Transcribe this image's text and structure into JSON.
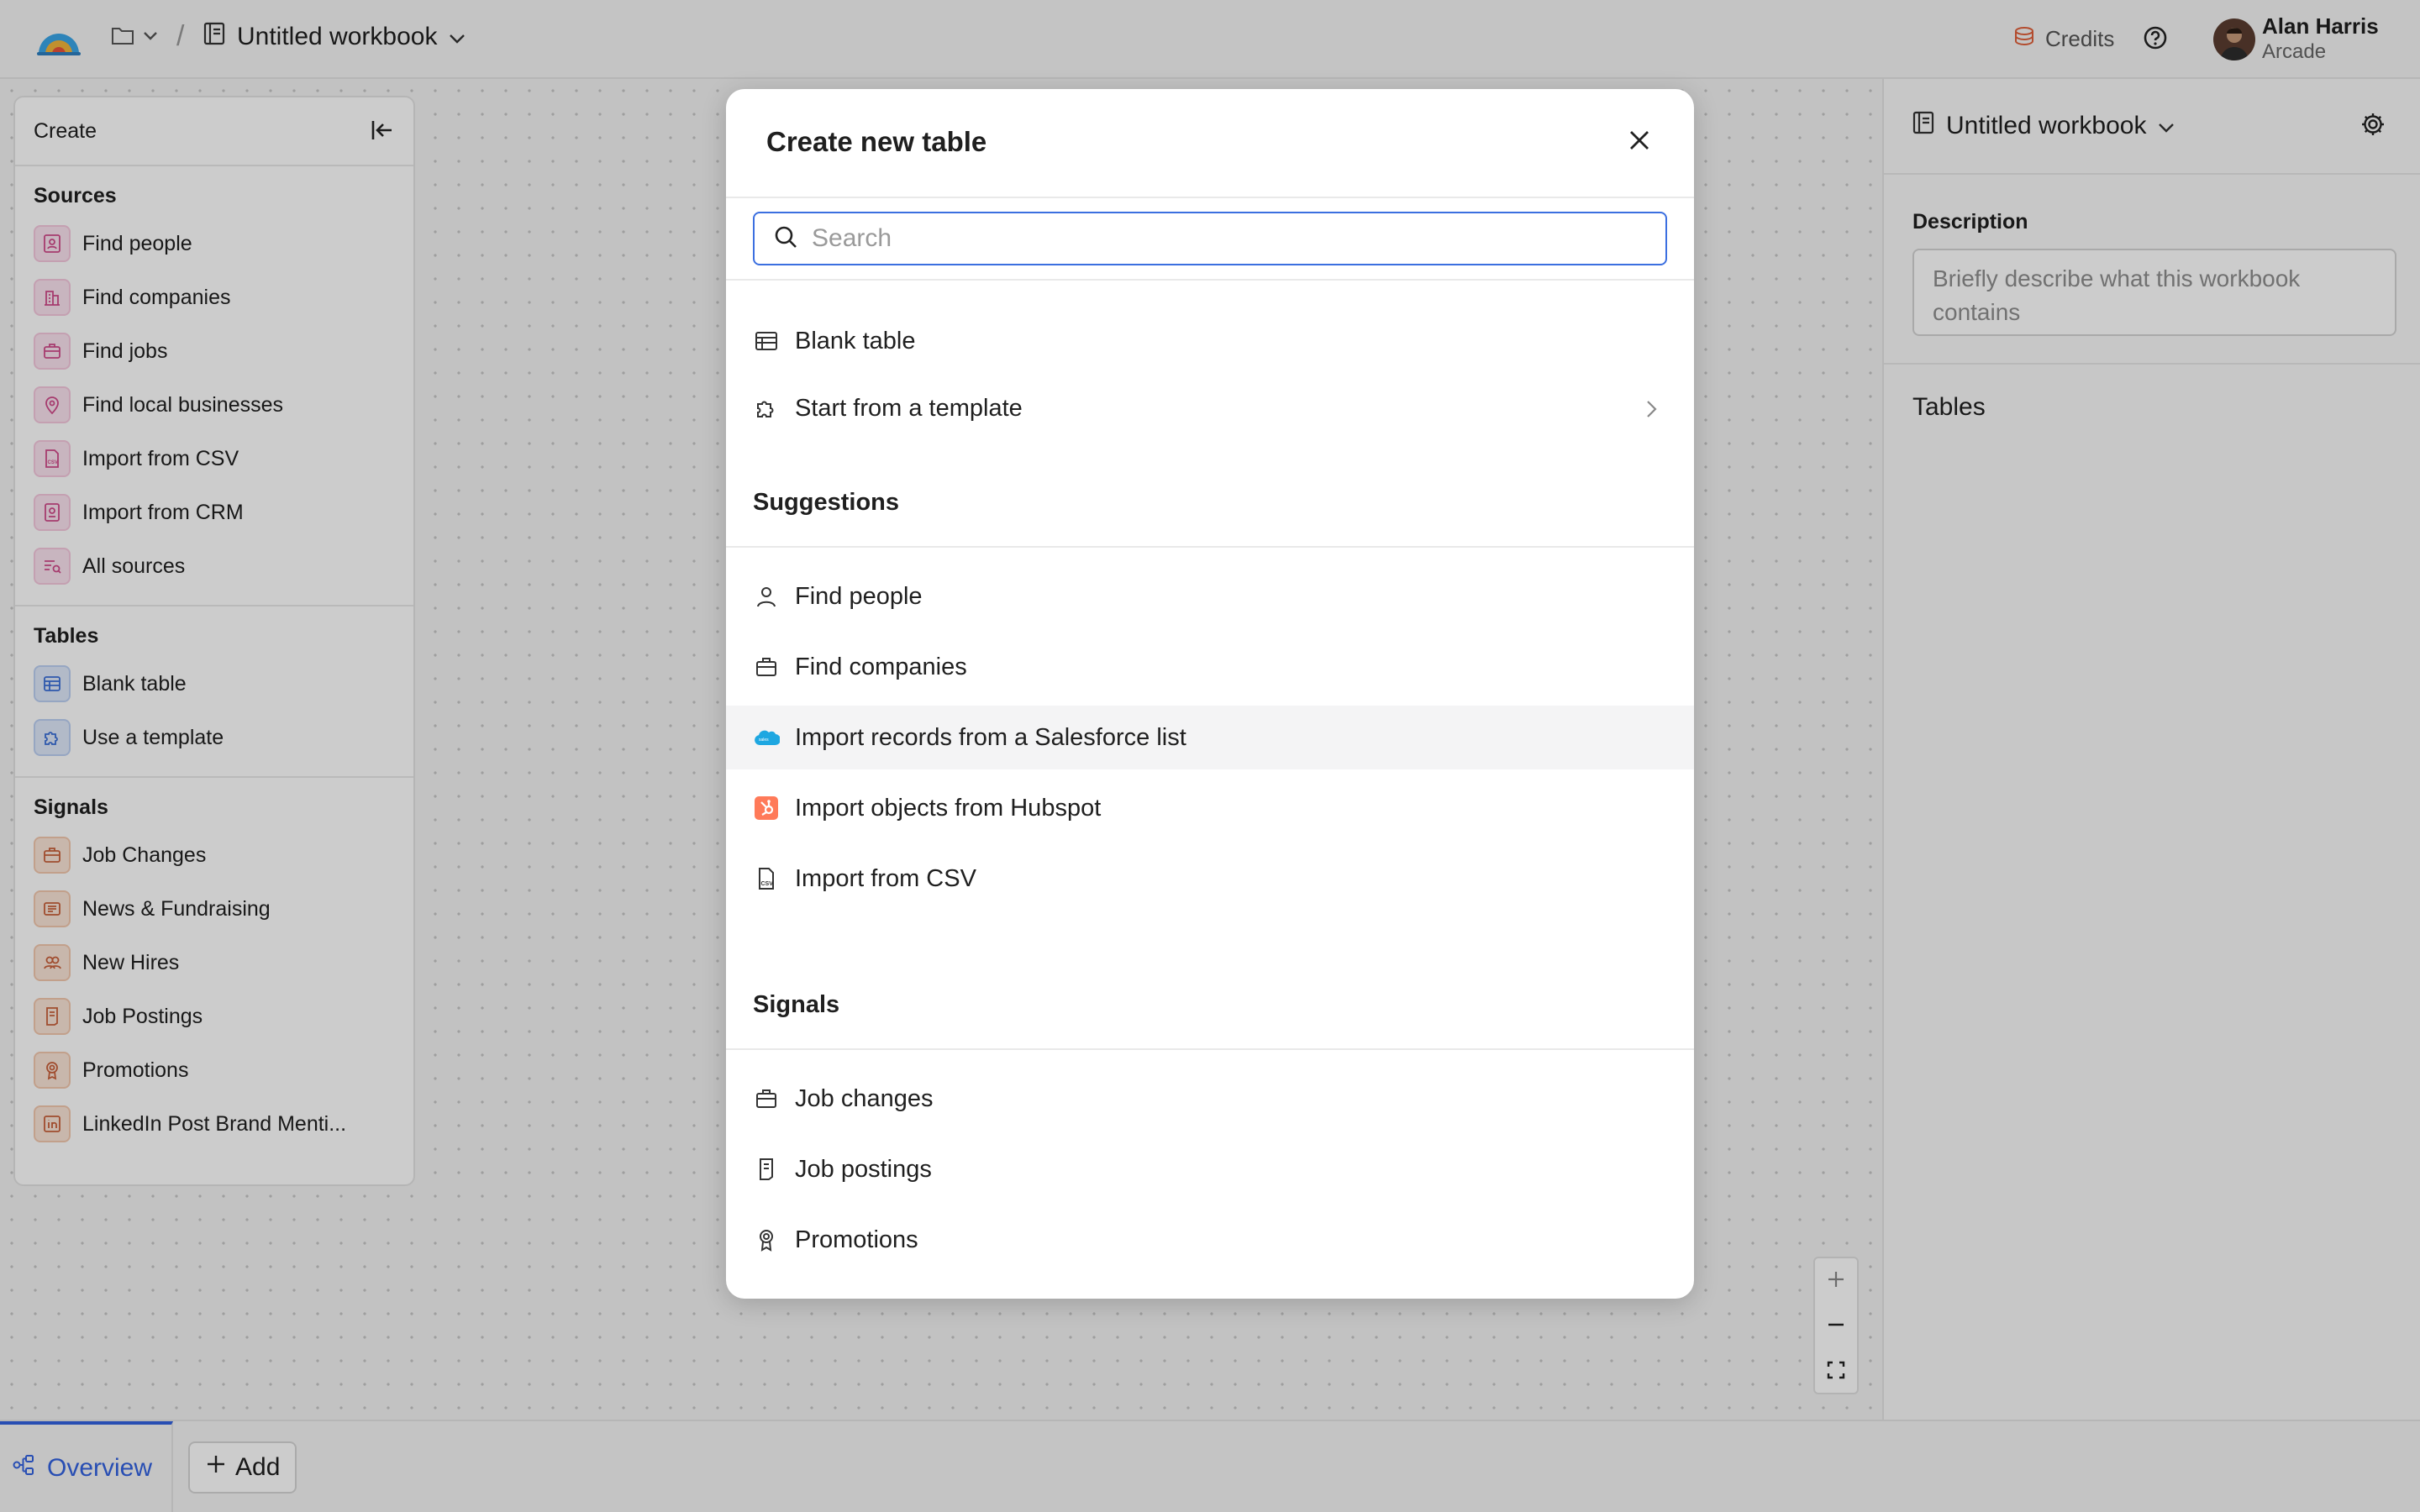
{
  "topbar": {
    "workbook_title": "Untitled workbook",
    "breadcrumb_sep": "/",
    "credits_label": "Credits",
    "user_name": "Alan Harris",
    "user_org": "Arcade"
  },
  "left_panel": {
    "header": "Create",
    "sources_title": "Sources",
    "sources": [
      {
        "label": "Find people",
        "icon": "person-card-icon"
      },
      {
        "label": "Find companies",
        "icon": "building-icon"
      },
      {
        "label": "Find jobs",
        "icon": "briefcase-icon"
      },
      {
        "label": "Find local businesses",
        "icon": "map-pin-icon"
      },
      {
        "label": "Import from CSV",
        "icon": "csv-file-icon"
      },
      {
        "label": "Import from CRM",
        "icon": "crm-icon"
      },
      {
        "label": "All sources",
        "icon": "list-search-icon"
      }
    ],
    "tables_title": "Tables",
    "tables": [
      {
        "label": "Blank table",
        "icon": "table-icon"
      },
      {
        "label": "Use a template",
        "icon": "puzzle-icon"
      }
    ],
    "signals_title": "Signals",
    "signals": [
      {
        "label": "Job Changes",
        "icon": "briefcase-icon"
      },
      {
        "label": "News & Fundraising",
        "icon": "newspaper-icon"
      },
      {
        "label": "New Hires",
        "icon": "users-icon"
      },
      {
        "label": "Job Postings",
        "icon": "document-icon"
      },
      {
        "label": "Promotions",
        "icon": "award-icon"
      },
      {
        "label": "LinkedIn Post Brand Menti...",
        "icon": "linkedin-icon"
      }
    ]
  },
  "right_panel": {
    "workbook_title": "Untitled workbook",
    "description_label": "Description",
    "description_placeholder": "Briefly describe what this workbook contains",
    "tables_label": "Tables"
  },
  "bottombar": {
    "overview_label": "Overview",
    "add_label": "Add"
  },
  "modal": {
    "title": "Create new table",
    "search_placeholder": "Search",
    "blank_table": "Blank table",
    "start_template": "Start from a template",
    "suggestions_title": "Suggestions",
    "suggestions": [
      "Find people",
      "Find companies",
      "Import records from a Salesforce list",
      "Import objects from Hubspot",
      "Import from CSV"
    ],
    "signals_title": "Signals",
    "signals": [
      "Job changes",
      "Job postings",
      "Promotions"
    ]
  },
  "colors": {
    "accent": "#3262e0",
    "hubspot": "#ff7a59",
    "salesforce": "#1ea7e1"
  }
}
